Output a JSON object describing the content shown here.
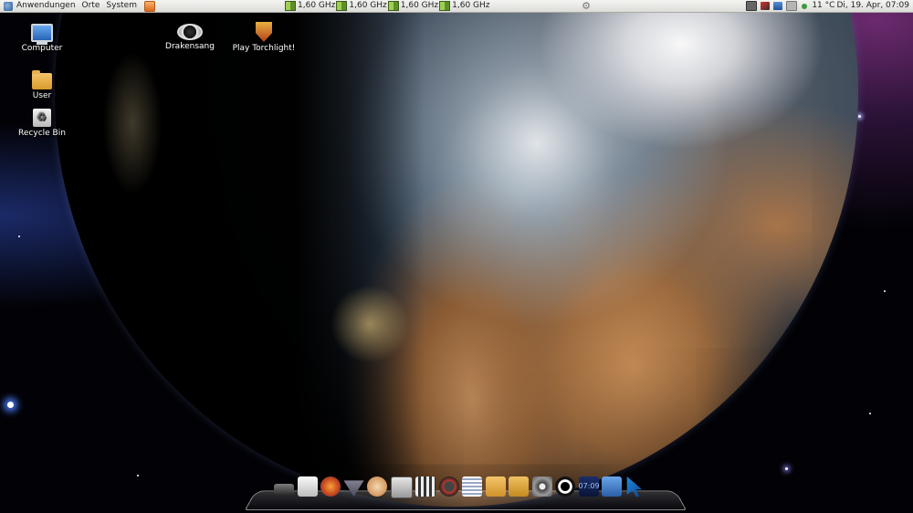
{
  "panel": {
    "menus": [
      "Anwendungen",
      "Orte",
      "System"
    ],
    "cpu_monitors": [
      "1,60 GHz",
      "1,60 GHz",
      "1,60 GHz",
      "1,60 GHz"
    ],
    "weather": "11 °C",
    "clock": "Di, 19. Apr, 07:09",
    "icons": [
      "gnome-foot-icon",
      "launcher-icon",
      "cpu-chip-icon",
      "gear-icon",
      "network-icon",
      "volume-icon",
      "battery-icon"
    ]
  },
  "desktop": {
    "icons": [
      {
        "label": "Computer",
        "icon": "computer-icon"
      },
      {
        "label": "User",
        "icon": "folder-icon"
      },
      {
        "label": "Recycle Bin",
        "icon": "recycle-bin-icon"
      },
      {
        "label": "Drakensang",
        "icon": "drakensang-icon"
      },
      {
        "label": "Play Torchlight!",
        "icon": "torchlight-icon"
      }
    ]
  },
  "dock": {
    "items": [
      {
        "name": "terminal-icon"
      },
      {
        "name": "document-icon"
      },
      {
        "name": "firefox-icon"
      },
      {
        "name": "download-icon"
      },
      {
        "name": "pidgin-icon"
      },
      {
        "name": "display-icon"
      },
      {
        "name": "film-icon"
      },
      {
        "name": "media-player-icon"
      },
      {
        "name": "text-editor-icon"
      },
      {
        "name": "folder-icon"
      },
      {
        "name": "archive-icon"
      },
      {
        "name": "disc-burner-icon"
      },
      {
        "name": "power-icon"
      },
      {
        "name": "clock-icon",
        "text": "07:09"
      },
      {
        "name": "monitor-icon"
      },
      {
        "name": "cursor-icon"
      }
    ]
  }
}
